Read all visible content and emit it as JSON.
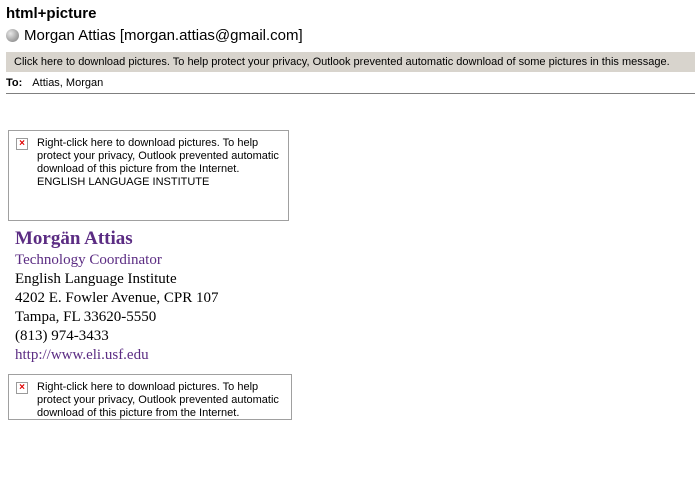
{
  "message": {
    "subject": "html+picture",
    "sender": "Morgan Attias [morgan.attias@gmail.com]",
    "infobar": "Click here to download pictures. To help protect your privacy, Outlook prevented automatic download of some pictures in this message.",
    "to_label": "To:",
    "to_value": "Attias, Morgan"
  },
  "images": [
    {
      "placeholder": "Right-click here to download pictures. To help protect your privacy, Outlook prevented automatic download of this picture from the Internet.",
      "alt": "ENGLISH LANGUAGE INSTITUTE"
    },
    {
      "placeholder": "Right-click here to download pictures. To help protect your privacy, Outlook prevented automatic download of this picture from the Internet."
    }
  ],
  "signature": {
    "name": "Morgän Attias",
    "title": "Technology Coordinator",
    "org": "English Language Institute",
    "address1": "4202 E. Fowler Avenue, CPR 107",
    "address2": "Tampa, FL 33620-5550",
    "phone": "(813) 974-3433",
    "url": "http://www.eli.usf.edu"
  },
  "colors": {
    "accent": "#5b2c83",
    "infobar_bg": "#d8d4cd",
    "broken_x": "#e00000"
  }
}
